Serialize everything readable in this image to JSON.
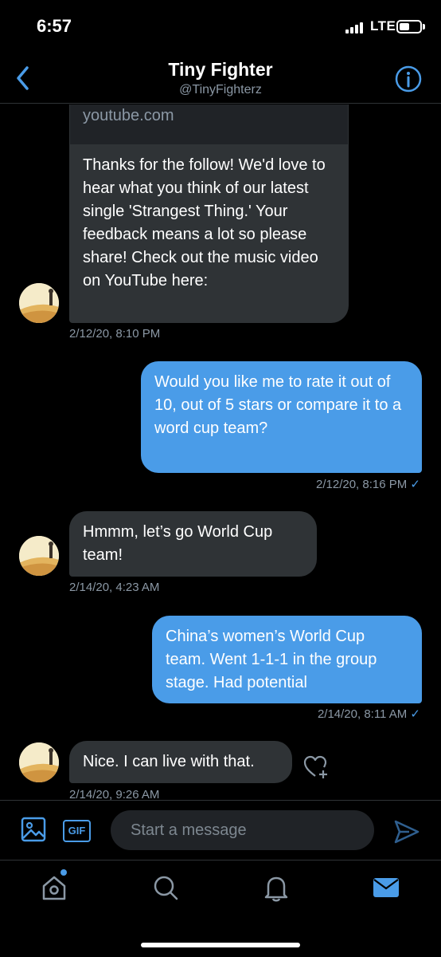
{
  "status_bar": {
    "time": "6:57",
    "network": "LTE",
    "battery_level": 0.5
  },
  "header": {
    "title": "Tiny Fighter",
    "handle": "@TinyFighterz"
  },
  "messages": [
    {
      "direction": "incoming",
      "link_domain": "youtube.com",
      "text": "Thanks for the follow! We'd love to hear what you think of our latest single 'Strangest Thing.' Your feedback means a lot so please share! Check out the music video on YouTube here:",
      "timestamp": "2/12/20, 8:10 PM"
    },
    {
      "direction": "outgoing",
      "text": "Would you like me to rate it out of 10, out of 5 stars or compare it to a word cup team?",
      "timestamp": "2/12/20, 8:16 PM",
      "status_icon": "check-icon"
    },
    {
      "direction": "incoming",
      "text": "Hmmm, let’s go World Cup team!",
      "timestamp": "2/14/20, 4:23 AM"
    },
    {
      "direction": "outgoing",
      "text": "China’s women’s World Cup team. Went 1-1-1 in the group stage. Had potential",
      "timestamp": "2/14/20, 8:11 AM",
      "status_icon": "check-icon"
    },
    {
      "direction": "incoming",
      "text": "Nice. I can live with that.",
      "timestamp": "2/14/20, 9:26 AM",
      "reaction_icon": "heart-plus-icon"
    }
  ],
  "composer": {
    "placeholder": "Start a message",
    "gif_label": "GIF"
  },
  "tabbar": {
    "items": [
      "home-icon",
      "search-icon",
      "notifications-icon",
      "messages-icon"
    ],
    "active": "messages-icon",
    "home_has_notification": true
  },
  "colors": {
    "accent": "#4a9ce8",
    "incoming_bubble": "#2f3336",
    "secondary_text": "#8b98a5"
  }
}
